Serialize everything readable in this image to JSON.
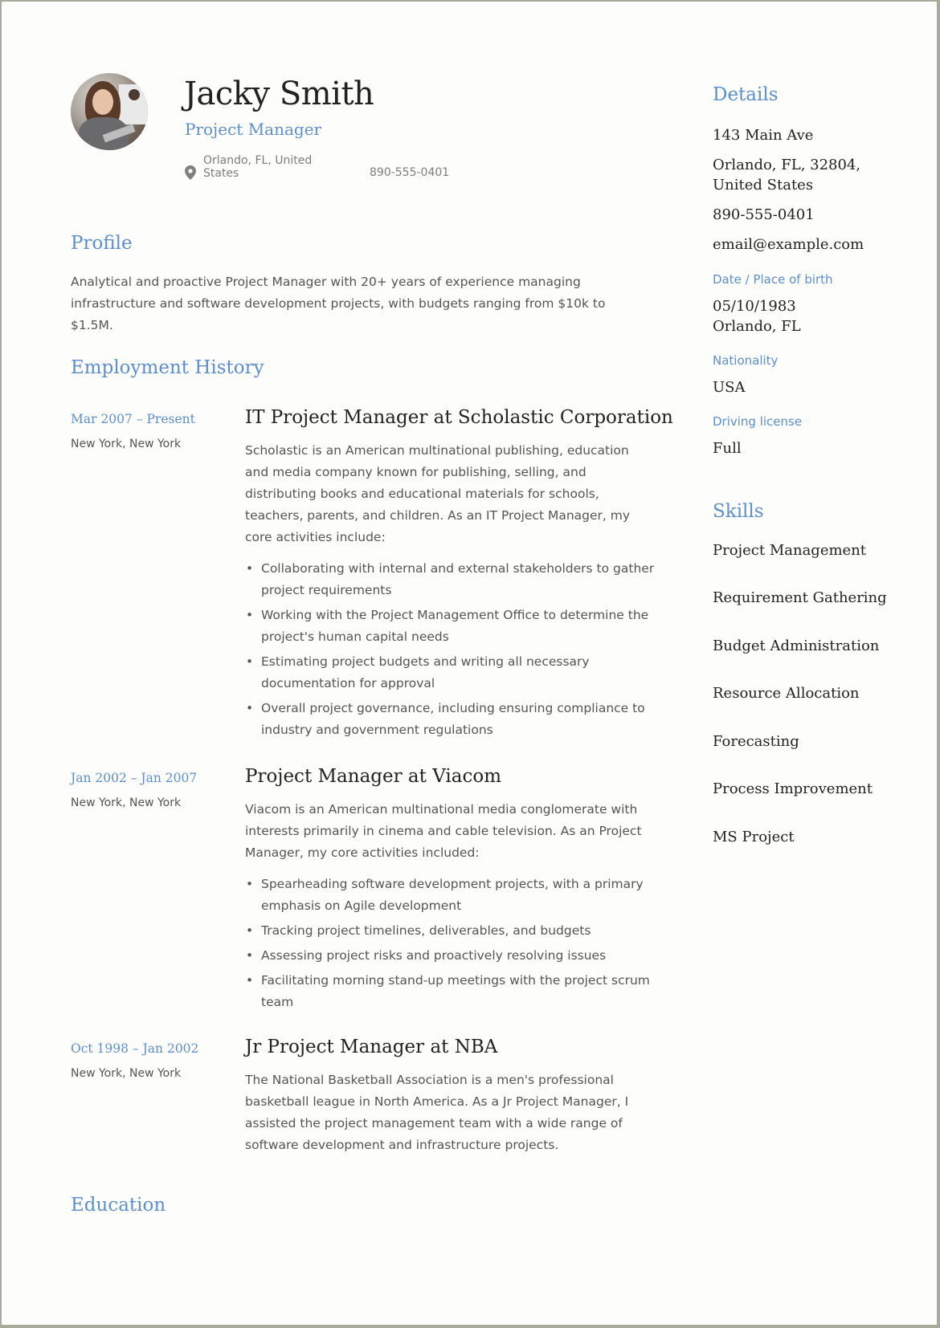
{
  "header": {
    "name": "Jacky Smith",
    "job_title": "Project Manager",
    "location": "Orlando, FL, United States",
    "phone": "890-555-0401",
    "avatar_icon": "profile-photo"
  },
  "profile": {
    "heading": "Profile",
    "text": "Analytical and proactive Project Manager with 20+ years of experience managing infrastructure and software development projects, with budgets ranging from $10k to $1.5M."
  },
  "employment": {
    "heading": "Employment History",
    "jobs": [
      {
        "dates": "Mar 2007 – Present",
        "city": "New York, New York",
        "title": "IT Project Manager at Scholastic Corporation",
        "description": "Scholastic is an American multinational publishing, education and media company known for publishing, selling, and distributing books and educational materials for schools, teachers, parents, and children. As an IT Project Manager, my core activities include:",
        "bullets": [
          "Collaborating with internal and external stakeholders to gather project requirements",
          "Working with the Project Management Office to determine the project's human capital needs",
          "Estimating project budgets and writing all necessary documentation for approval",
          "Overall project governance, including ensuring compliance to industry and government regulations"
        ]
      },
      {
        "dates": "Jan 2002 – Jan 2007",
        "city": "New York, New York",
        "title": "Project Manager at Viacom",
        "description": "Viacom is an American multinational media conglomerate with interests primarily in cinema and cable television. As an Project Manager, my core activities included:",
        "bullets": [
          "Spearheading software development projects, with a primary emphasis on Agile development",
          "Tracking project timelines, deliverables, and budgets",
          "Assessing project risks and proactively resolving issues",
          "Facilitating morning stand-up meetings with the project scrum team"
        ]
      },
      {
        "dates": "Oct 1998 – Jan 2002",
        "city": "New York, New York",
        "title": "Jr Project Manager at NBA",
        "description": "The National Basketball Association is a men's professional basketball league in North America. As a Jr Project Manager, I assisted the project management team with a wide range of software development and infrastructure projects.",
        "bullets": []
      }
    ]
  },
  "education": {
    "heading": "Education"
  },
  "details": {
    "heading": "Details",
    "address": "143 Main Ave",
    "city_line": "Orlando, FL, 32804, United States",
    "phone": "890-555-0401",
    "email": "email@example.com",
    "birth_label": "Date / Place of birth",
    "birth_date": "05/10/1983",
    "birth_place": "Orlando, FL",
    "nationality_label": "Nationality",
    "nationality": "USA",
    "license_label": "Driving license",
    "license": "Full"
  },
  "skills": {
    "heading": "Skills",
    "items": [
      "Project Management",
      "Requirement Gathering",
      "Budget Administration",
      "Resource Allocation",
      "Forecasting",
      "Process Improvement",
      "MS Project"
    ]
  },
  "colors": {
    "accent": "#5b8fd0",
    "text": "#222222",
    "muted": "#555555",
    "frame": "#a9aa9c"
  }
}
